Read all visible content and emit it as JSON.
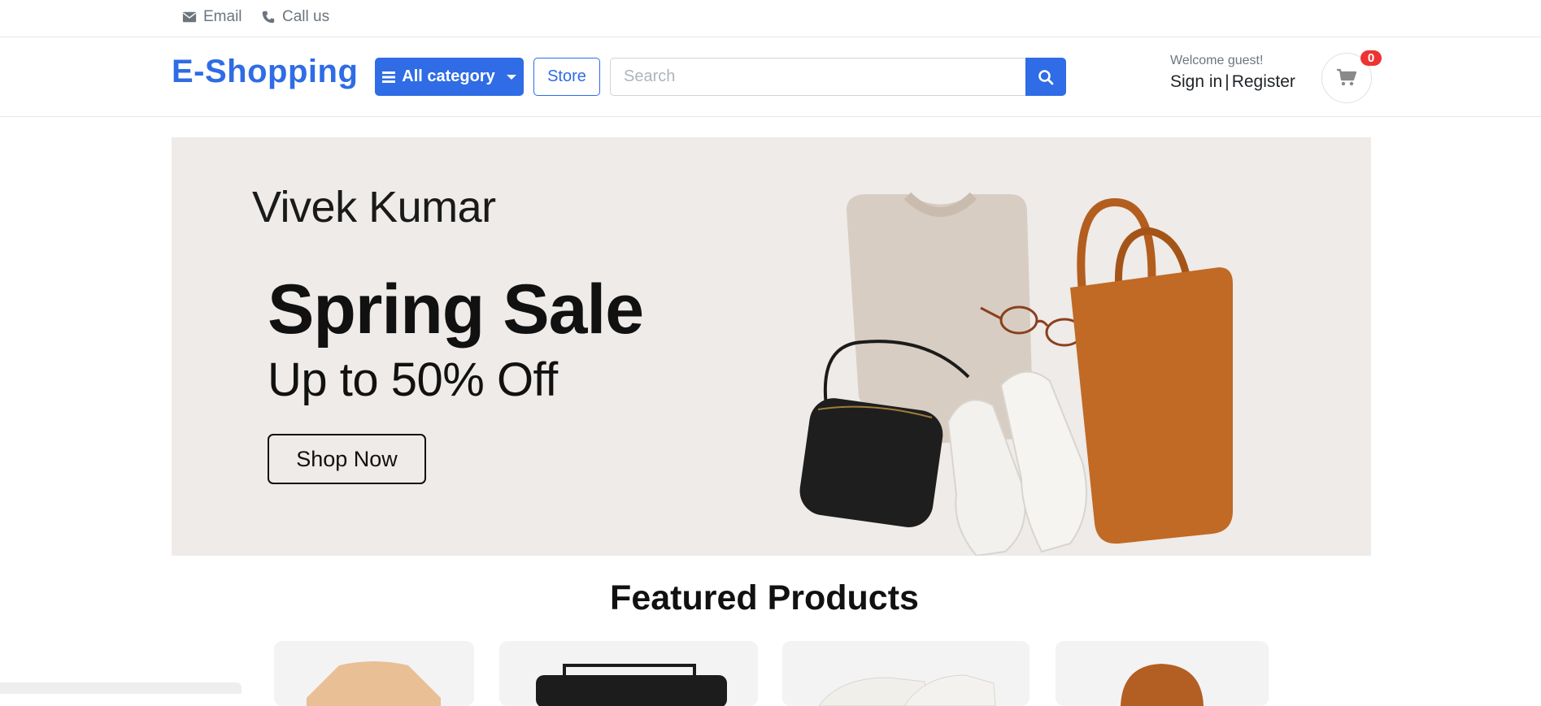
{
  "topbar": {
    "email_label": "Email",
    "call_label": "Call us"
  },
  "header": {
    "brand": "E-Shopping",
    "category_button": "All category",
    "store_button": "Store",
    "search_placeholder": "Search",
    "welcome": "Welcome guest!",
    "sign_in": "Sign in",
    "separator": "|",
    "register": "Register",
    "cart_count": "0"
  },
  "hero": {
    "name": "Vivek Kumar",
    "headline": "Spring Sale",
    "subheadline": "Up to 50% Off",
    "cta": "Shop Now"
  },
  "featured": {
    "title": "Featured Products",
    "products": [
      {
        "icon": "tshirt-image"
      },
      {
        "icon": "black-bag-image"
      },
      {
        "icon": "sneakers-image"
      },
      {
        "icon": "brown-hat-image"
      }
    ]
  },
  "colors": {
    "primary": "#2f6ce5",
    "badge": "#ee3333",
    "hero_bg": "#eeebe8"
  }
}
